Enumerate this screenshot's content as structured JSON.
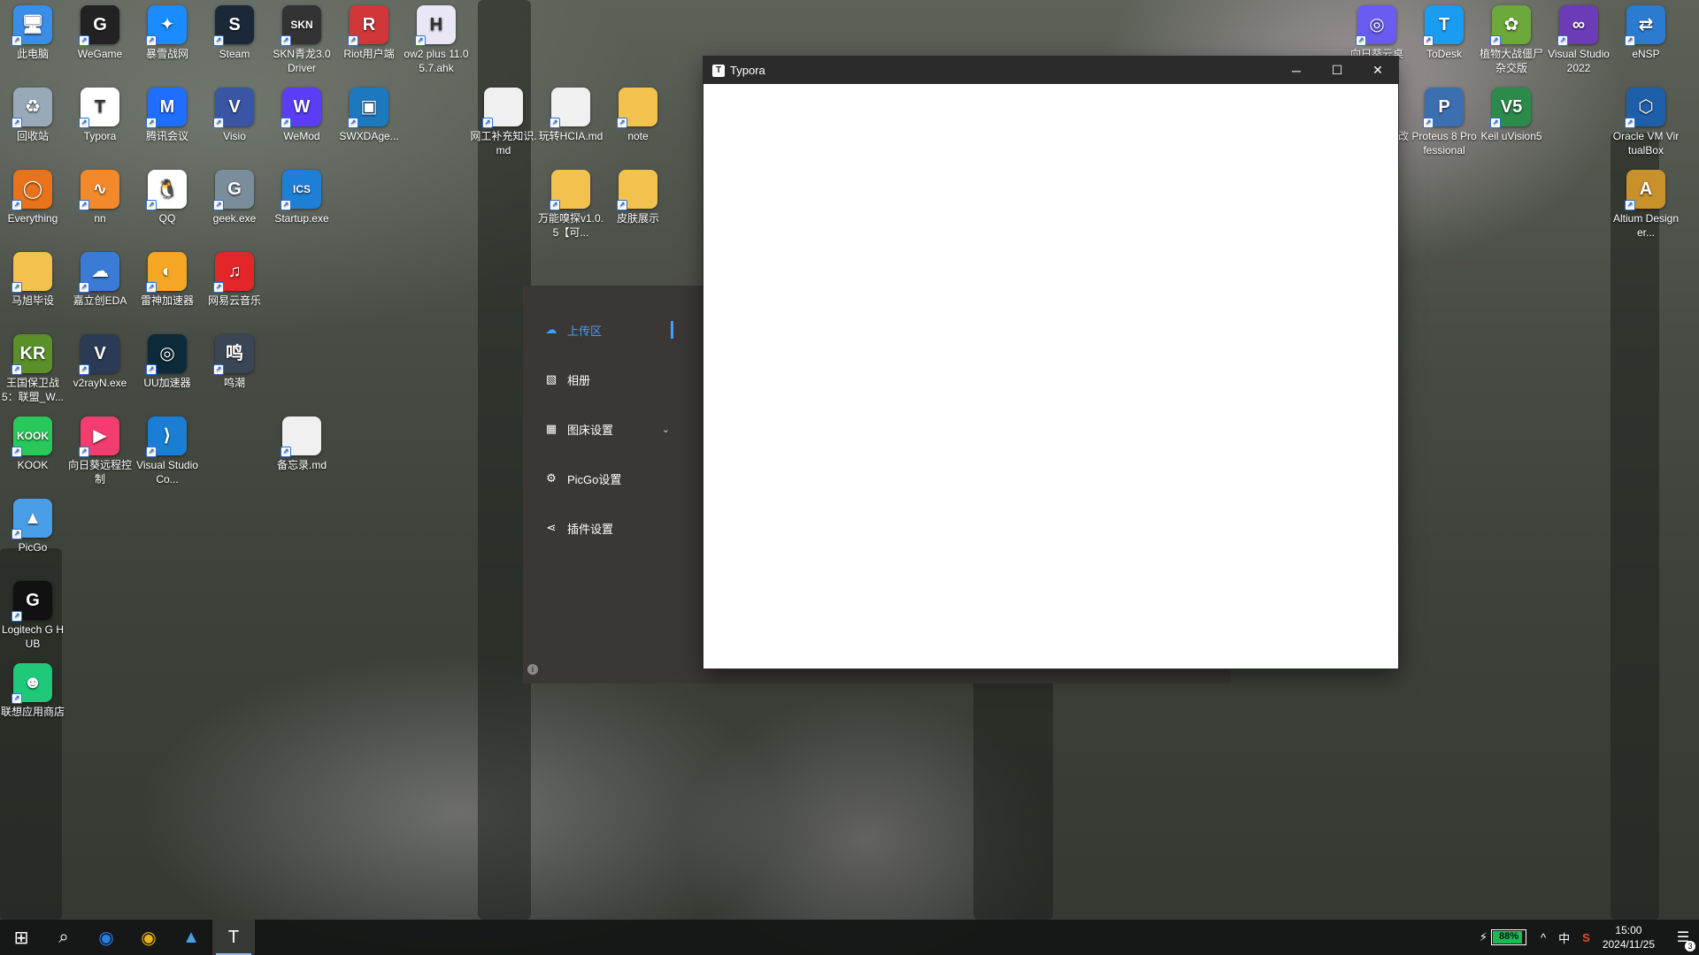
{
  "desktop": {
    "icons": [
      {
        "label": "此电脑",
        "icon": "computer-icon",
        "color": "#3b8ee8",
        "glyph": "🖥"
      },
      {
        "label": "WeGame",
        "icon": "wegame-icon",
        "color": "#222222",
        "glyph": "G"
      },
      {
        "label": "暴雪战网",
        "icon": "battlenet-icon",
        "color": "#1a8cff",
        "glyph": "✦"
      },
      {
        "label": "Steam",
        "icon": "steam-icon",
        "color": "#1b2838",
        "glyph": "S"
      },
      {
        "label": "SKN青龙3.0 Driver",
        "icon": "skn-driver-icon",
        "color": "#333333",
        "glyph": "SKN"
      },
      {
        "label": "Riot用户端",
        "icon": "riot-icon",
        "color": "#d13639",
        "glyph": "R"
      },
      {
        "label": "ow2 plus 11.05.7.ahk",
        "icon": "ahk-file-icon",
        "color": "#e9e6f5",
        "glyph": "H"
      },
      {
        "label": "回收站",
        "icon": "recycle-bin-icon",
        "color": "#9aa9b8",
        "glyph": "♻"
      },
      {
        "label": "Typora",
        "icon": "typora-icon",
        "color": "#ffffff",
        "glyph": "T"
      },
      {
        "label": "腾讯会议",
        "icon": "tencent-meeting-icon",
        "color": "#1e6fff",
        "glyph": "M"
      },
      {
        "label": "Visio",
        "icon": "visio-icon",
        "color": "#3955a3",
        "glyph": "V"
      },
      {
        "label": "WeMod",
        "icon": "wemod-icon",
        "color": "#5b3df5",
        "glyph": "W"
      },
      {
        "label": "SWXDAge...",
        "icon": "swxdage-icon",
        "color": "#1c79c0",
        "glyph": "▣"
      },
      {
        "label": "网工补充知识.md",
        "icon": "md-file-icon",
        "color": "#f0f0f0",
        "glyph": ""
      },
      {
        "label": "玩转HCIA.md",
        "icon": "md-file-icon",
        "color": "#f0f0f0",
        "glyph": ""
      },
      {
        "label": "note",
        "icon": "folder-icon",
        "color": "#f3c24e",
        "glyph": ""
      },
      {
        "label": "Everything",
        "icon": "everything-icon",
        "color": "#e8731a",
        "glyph": "◯"
      },
      {
        "label": "nn",
        "icon": "nn-accelerator-icon",
        "color": "#f28a2b",
        "glyph": "∿"
      },
      {
        "label": "QQ",
        "icon": "qq-icon",
        "color": "#ffffff",
        "glyph": "🐧"
      },
      {
        "label": "geek.exe",
        "icon": "geek-uninstaller-icon",
        "color": "#7a8d9a",
        "glyph": "G"
      },
      {
        "label": "Startup.exe",
        "icon": "startup-icon",
        "color": "#1e7fd6",
        "glyph": "ICS"
      },
      {
        "label": "万能嗅探v1.0.5【可...",
        "icon": "folder-icon",
        "color": "#f3c24e",
        "glyph": ""
      },
      {
        "label": "皮肤展示",
        "icon": "folder-icon",
        "color": "#f3c24e",
        "glyph": ""
      },
      {
        "label": "马旭毕设",
        "icon": "folder-icon",
        "color": "#f3c24e",
        "glyph": ""
      },
      {
        "label": "嘉立创EDA",
        "icon": "jlc-eda-icon",
        "color": "#3a7bd5",
        "glyph": "☁"
      },
      {
        "label": "雷神加速器",
        "icon": "leishen-icon",
        "color": "#f5a623",
        "glyph": "◐"
      },
      {
        "label": "网易云音乐",
        "icon": "netease-music-icon",
        "color": "#e2262a",
        "glyph": "♫"
      },
      {
        "label": "王国保卫战 5：联盟_W...",
        "icon": "kingdom-rush-icon",
        "color": "#5a8f2a",
        "glyph": "KR"
      },
      {
        "label": "v2rayN.exe",
        "icon": "v2rayn-icon",
        "color": "#2b3a55",
        "glyph": "V"
      },
      {
        "label": "UU加速器",
        "icon": "uu-accelerator-icon",
        "color": "#0b2a3a",
        "glyph": "◎"
      },
      {
        "label": "鸣潮",
        "icon": "wuthering-waves-icon",
        "color": "#3a4556",
        "glyph": "鸣"
      },
      {
        "label": "KOOK",
        "icon": "kook-icon",
        "color": "#28c85a",
        "glyph": "KOOK"
      },
      {
        "label": "向日葵远程控制",
        "icon": "sunlogin-icon",
        "color": "#f23d6e",
        "glyph": "▶"
      },
      {
        "label": "Visual Studio Co...",
        "icon": "vscode-icon",
        "color": "#1a7fd4",
        "glyph": "⟩"
      },
      {
        "label": "备忘录.md",
        "icon": "md-file-icon",
        "color": "#f0f0f0",
        "glyph": ""
      },
      {
        "label": "PicGo",
        "icon": "picgo-icon",
        "color": "#4a9ee8",
        "glyph": "▲"
      },
      {
        "label": "Logitech G HUB",
        "icon": "logitech-ghub-icon",
        "color": "#111111",
        "glyph": "G"
      },
      {
        "label": "联想应用商店",
        "icon": "lenovo-store-icon",
        "color": "#1ec97a",
        "glyph": "☻"
      },
      {
        "label": "向日葵云桌",
        "icon": "cloud-desktop-icon",
        "color": "#6a5cf0",
        "glyph": "◎"
      },
      {
        "label": "ToDesk",
        "icon": "todesk-icon",
        "color": "#1a9cf0",
        "glyph": "T"
      },
      {
        "label": "植物大战僵尸杂交版",
        "icon": "pvz-icon",
        "color": "#6ca83a",
        "glyph": "✿"
      },
      {
        "label": "Visual Studio 2022",
        "icon": "visual-studio-icon",
        "color": "#6c3bb8",
        "glyph": "∞"
      },
      {
        "label": "eNSP",
        "icon": "ensp-icon",
        "color": "#2b7bd0",
        "glyph": "⇄"
      },
      {
        "label": "风灵月影修改器",
        "icon": "flingtrainer-icon",
        "color": "#202020",
        "glyph": "风"
      },
      {
        "label": "Proteus 8 Professional",
        "icon": "proteus-icon",
        "color": "#3b6fb0",
        "glyph": "P"
      },
      {
        "label": "Keil uVision5",
        "icon": "keil-icon",
        "color": "#2c8a4a",
        "glyph": "V5"
      },
      {
        "label": "Oracle VM VirtualBox",
        "icon": "virtualbox-icon",
        "color": "#1d5fa8",
        "glyph": "⬡"
      },
      {
        "label": "Altium Designer...",
        "icon": "altium-icon",
        "color": "#c8912a",
        "glyph": "A"
      }
    ]
  },
  "typora_window": {
    "title": "Typora",
    "app_glyph": "T",
    "minimize": "─",
    "maximize": "☐",
    "close": "✕"
  },
  "picgo_panel": {
    "menu": [
      {
        "label": "上传区",
        "icon": "cloud-upload-icon",
        "glyph": "☁",
        "active": true
      },
      {
        "label": "相册",
        "icon": "image-icon",
        "glyph": "▧",
        "active": false
      },
      {
        "label": "图床设置",
        "icon": "grid-icon",
        "glyph": "▦",
        "active": false
      },
      {
        "label": "PicGo设置",
        "icon": "gear-icon",
        "glyph": "⚙",
        "active": false
      },
      {
        "label": "插件设置",
        "icon": "share-icon",
        "glyph": "⋖",
        "active": false
      }
    ],
    "chevron": "⌄",
    "info_glyph": "i",
    "accent": "#409eff"
  },
  "taskbar": {
    "start_glyph": "⊞",
    "search_glyph": "⌕",
    "apps": [
      {
        "name": "edge-icon",
        "glyph": "◉",
        "color": "#2a7de1"
      },
      {
        "name": "chrome-icon",
        "glyph": "◉",
        "color": "#e8b21f"
      },
      {
        "name": "picgo-taskbar-icon",
        "glyph": "▲",
        "color": "#4a9ee8"
      },
      {
        "name": "typora-taskbar-icon",
        "glyph": "T",
        "color": "#ffffff"
      }
    ],
    "battery_percent": "88%",
    "battery_level": 0.88,
    "tray_up": "^",
    "ime": "中",
    "sogou_glyph": "S",
    "time": "15:00",
    "date": "2024/11/25",
    "notification_count": "3",
    "notification_glyph": "☰"
  }
}
